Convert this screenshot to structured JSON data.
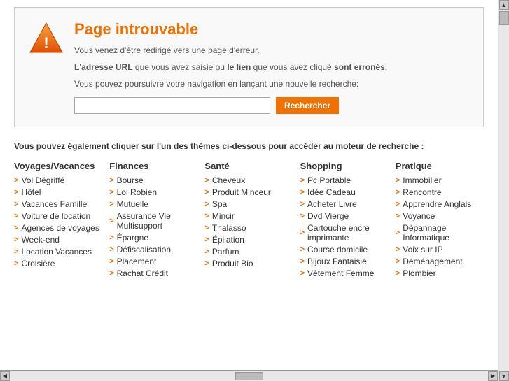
{
  "error": {
    "title": "Page introuvable",
    "subtitle": "Vous venez d'être redirigé vers une page d'erreur.",
    "url_label": "L'adresse URL",
    "url_middle": " que vous avez saisie ou ",
    "link_label": "le lien",
    "link_middle": " que vous avez cliqué ",
    "bold_end": "sont erronés.",
    "navigation_text": "Vous pouvez poursuivre votre navigation en lançant une nouvelle recherche:",
    "search_placeholder": "",
    "search_button": "Rechercher"
  },
  "categories": {
    "intro": "Vous pouvez également cliquer sur l'un des thèmes ci-dessous pour accéder au moteur de recherche :",
    "columns": [
      {
        "title": "Voyages/Vacances",
        "items": [
          "Vol Dégriffé",
          "Hôtel",
          "Vacances Famille",
          "Voiture de location",
          "Agences de voyages",
          "Week-end",
          "Location Vacances",
          "Croisière"
        ]
      },
      {
        "title": "Finances",
        "items": [
          "Bourse",
          "Loi Robien",
          "Mutuelle",
          "Assurance Vie Multisupport",
          "Épargne",
          "Défiscalisation",
          "Placement",
          "Rachat Crédit"
        ]
      },
      {
        "title": "Santé",
        "items": [
          "Cheveux",
          "Produit Minceur",
          "Spa",
          "Mincir",
          "Thalasso",
          "Épilation",
          "Parfum",
          "Produit Bio"
        ]
      },
      {
        "title": "Shopping",
        "items": [
          "Pc Portable",
          "Idée Cadeau",
          "Acheter Livre",
          "Dvd Vierge",
          "Cartouche encre imprimante",
          "Course domicile",
          "Bijoux Fantaisie",
          "Vêtement Femme"
        ]
      },
      {
        "title": "Pratique",
        "items": [
          "Immobilier",
          "Rencontre",
          "Apprendre Anglais",
          "Voyance",
          "Dépannage Informatique",
          "Voix sur IP",
          "Déménagement",
          "Plombier"
        ]
      }
    ]
  }
}
